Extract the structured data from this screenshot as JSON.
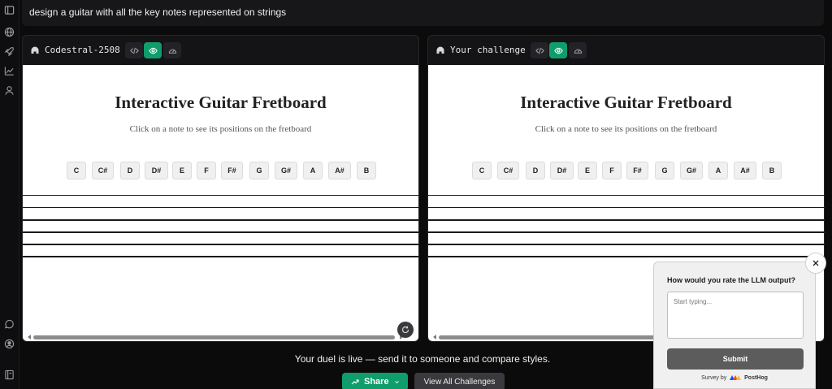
{
  "prompt": "design a guitar with all the key notes represented on strings",
  "panels": [
    {
      "model": "Codestral-2508",
      "title": "Interactive Guitar Fretboard",
      "subtitle": "Click on a note to see its positions on the fretboard"
    },
    {
      "model": "Your challenge",
      "title": "Interactive Guitar Fretboard",
      "subtitle": "Click on a note to see its positions on the fretboard"
    }
  ],
  "notes": [
    "C",
    "C#",
    "D",
    "D#",
    "E",
    "F",
    "F#",
    "G",
    "G#",
    "A",
    "A#",
    "B"
  ],
  "footer": {
    "live_text": "Your duel is live — send it to someone and compare styles.",
    "share_label": "Share",
    "view_all_label": "View All Challenges"
  },
  "survey": {
    "question": "How would you rate the LLM output?",
    "placeholder": "Start typing...",
    "submit_label": "Submit",
    "by_label": "Survey by",
    "brand": "PostHog"
  },
  "colors": {
    "accent": "#0f9d6b",
    "background": "#0b0b0c"
  },
  "icons": {
    "rail": [
      "sidebar-toggle-icon",
      "globe-icon",
      "rocket-icon",
      "chart-icon",
      "user-icon",
      "chat-icon",
      "account-icon",
      "book-icon"
    ],
    "toolbar": [
      "code-icon",
      "eye-icon",
      "gauge-icon"
    ]
  }
}
